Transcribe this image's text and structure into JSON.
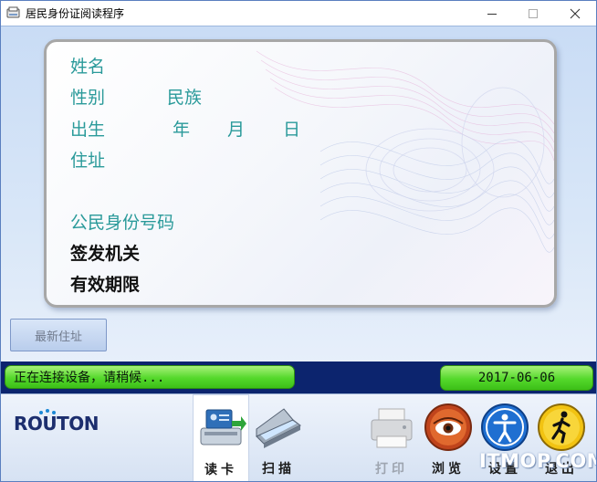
{
  "window": {
    "title": "居民身份证阅读程序"
  },
  "card": {
    "name_label": "姓名",
    "gender_label": "性别",
    "ethnicity_label": "民族",
    "birth_label": "出生",
    "year_label": "年",
    "month_label": "月",
    "day_label": "日",
    "address_label": "住址",
    "id_number_label": "公民身份号码",
    "authority_label": "签发机关",
    "validity_label": "有效期限"
  },
  "latest_address_button": "最新住址",
  "status": {
    "message": "正在连接设备，请稍候...",
    "date": "2017-06-06",
    "color": "#54d82b"
  },
  "toolbar": {
    "logo": "ROUTON",
    "read_card": "读卡",
    "scan": "扫描",
    "print": "打印",
    "browse": "浏览",
    "settings": "设置",
    "exit": "退出"
  },
  "watermark": "ITMOP.COM",
  "icons": [
    "id-reader-icon",
    "scanner-icon",
    "printer-icon",
    "eye-icon",
    "accessibility-icon",
    "exit-person-icon"
  ]
}
